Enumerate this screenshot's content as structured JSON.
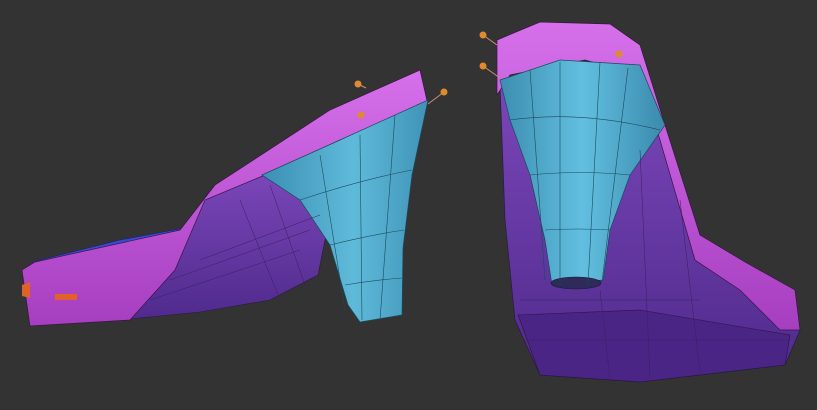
{
  "scene": {
    "background": "#333333",
    "models": [
      {
        "name": "shoe-left-side-view",
        "part_colors": {
          "upper": "#c055d8",
          "heel": "#4fa8c8",
          "sole": "#6a3aa8",
          "insole": "#3a4ad0",
          "accent": "#e0622a"
        }
      },
      {
        "name": "shoe-right-back-view",
        "part_colors": {
          "upper": "#c055d8",
          "heel": "#4fa8c8",
          "sole": "#6a3aa8"
        }
      }
    ],
    "markers": {
      "color": "#e08a30",
      "count": 6
    }
  }
}
